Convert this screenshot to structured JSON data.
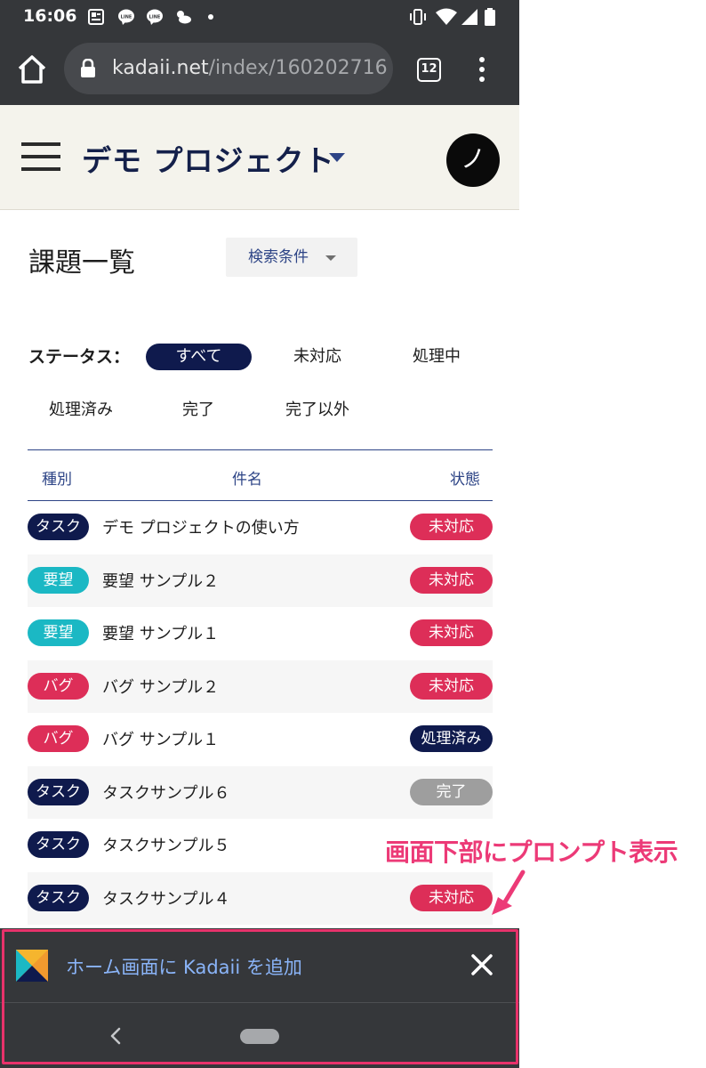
{
  "status_bar": {
    "time": "16:06",
    "left_icons": [
      "news-icon",
      "line-icon",
      "line-icon",
      "weather-icon",
      "dot-icon"
    ],
    "right_icons": [
      "vibrate-icon",
      "wifi-icon",
      "signal-icon",
      "battery-icon"
    ]
  },
  "browser": {
    "url_host": "kadaii.net",
    "url_path": "/index/160202716",
    "tab_count": "12",
    "icons": [
      "home-icon",
      "lock-icon",
      "tabs-icon",
      "more-vert-icon"
    ]
  },
  "app_header": {
    "project_name": "デモ プロジェクト",
    "avatar_letter": "ノ"
  },
  "page": {
    "title": "課題一覧",
    "search_label": "検索条件"
  },
  "status_filter": {
    "label": "ステータス：",
    "options": [
      "すべて",
      "未対応",
      "処理中",
      "処理済み",
      "完了",
      "完了以外"
    ],
    "selected": "すべて"
  },
  "table": {
    "headers": {
      "type": "種別",
      "title": "件名",
      "state": "状態"
    },
    "rows": [
      {
        "type": "タスク",
        "title": "デモ プロジェクトの使い方",
        "state": "未対応"
      },
      {
        "type": "要望",
        "title": "要望 サンプル２",
        "state": "未対応"
      },
      {
        "type": "要望",
        "title": "要望 サンプル１",
        "state": "未対応"
      },
      {
        "type": "バグ",
        "title": "バグ サンプル２",
        "state": "未対応"
      },
      {
        "type": "バグ",
        "title": "バグ サンプル１",
        "state": "処理済み"
      },
      {
        "type": "タスク",
        "title": "タスクサンプル６",
        "state": "完了"
      },
      {
        "type": "タスク",
        "title": "タスクサンプル５",
        "state": ""
      },
      {
        "type": "タスク",
        "title": "タスクサンプル４",
        "state": "未対応"
      }
    ]
  },
  "colors": {
    "task": "#0f1a4d",
    "request": "#1bb8c4",
    "bug": "#dd2e58",
    "unhandled": "#dd2e58",
    "processed": "#0f1a4d",
    "done": "#9e9e9e",
    "accent": "#2d4486",
    "annotation": "#ec3a77"
  },
  "install_prompt": {
    "text": "ホーム画面に Kadaii を追加"
  },
  "annotation": {
    "text": "画面下部にプロンプト表示"
  }
}
